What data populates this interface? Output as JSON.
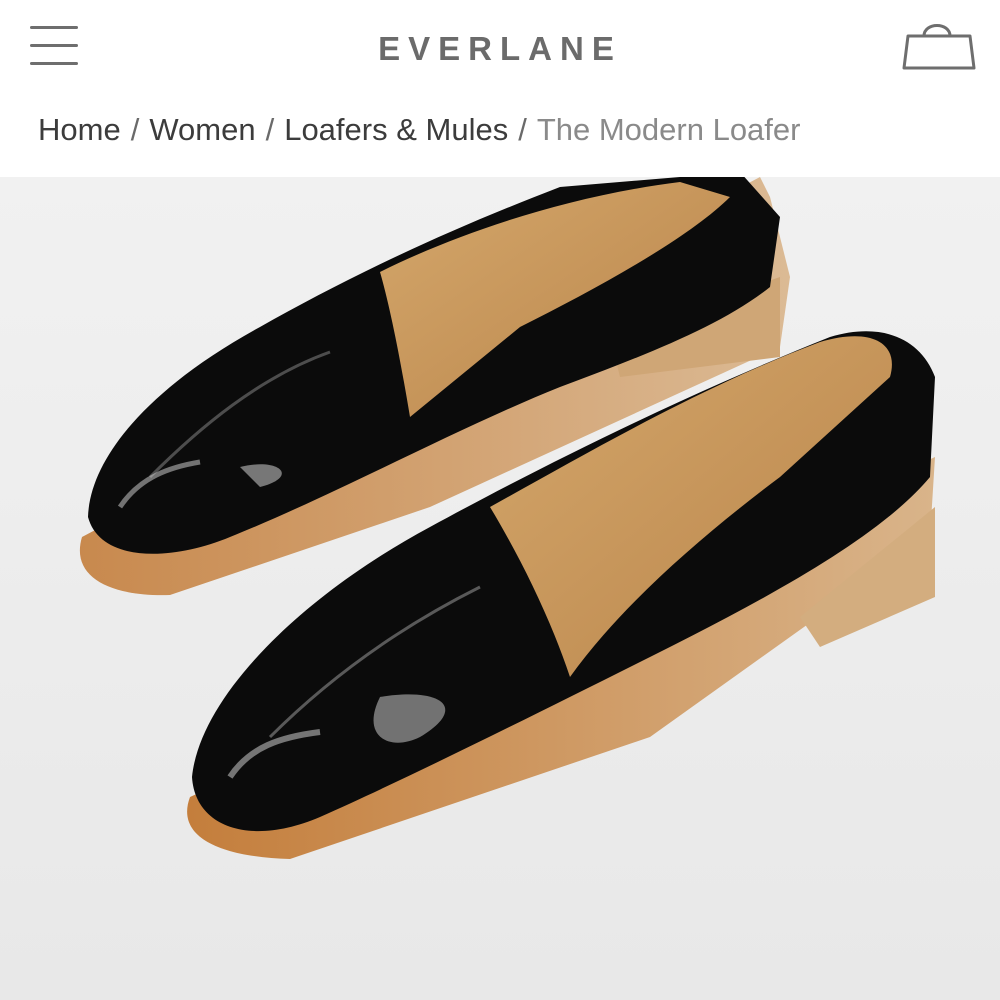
{
  "header": {
    "brand": "EVERLANE",
    "menu_icon": "hamburger-menu-icon",
    "cart_icon": "shopping-bag-icon"
  },
  "breadcrumb": {
    "items": [
      {
        "label": "Home"
      },
      {
        "label": "Women"
      },
      {
        "label": "Loafers & Mules"
      }
    ],
    "separator": "/",
    "current": "The Modern Loafer"
  },
  "product_image": {
    "subject": "black patent leather loafers",
    "colors": {
      "background": "#ededed",
      "leather": "#0b0b0b",
      "lining": "#c99a5e",
      "sole": "#c98a4a"
    }
  }
}
